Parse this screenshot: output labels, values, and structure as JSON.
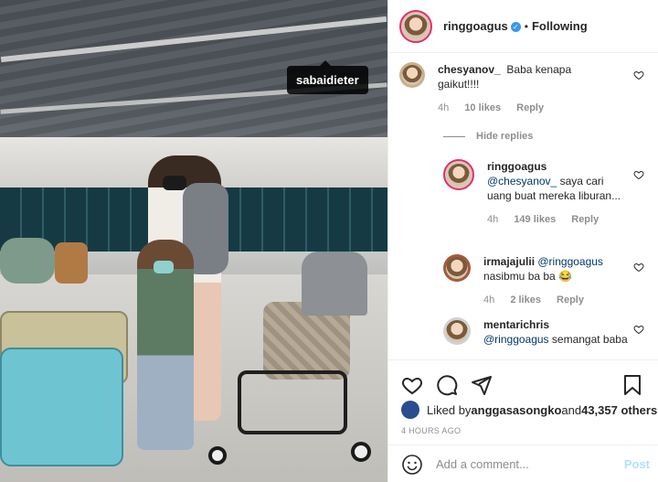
{
  "photo": {
    "tag_label": "sabaidieter"
  },
  "header": {
    "username": "ringgoagus",
    "separator": "•",
    "follow_status": "Following"
  },
  "comments": [
    {
      "username": "chesyanov_",
      "text": "Baba kenapa gaikut!!!!",
      "time": "4h",
      "likes": "10 likes",
      "reply": "Reply"
    }
  ],
  "hide_replies": "Hide replies",
  "replies": [
    {
      "username": "ringgoagus",
      "mention": "@chesyanov_",
      "text": " saya cari uang buat mereka liburan...",
      "time": "4h",
      "likes": "149 likes",
      "reply": "Reply"
    },
    {
      "username": "irmajajulii",
      "mention": "@ringgoagus",
      "text": "nasibmu ba ba 😂",
      "time": "4h",
      "likes": "2 likes",
      "reply": "Reply"
    },
    {
      "username": "mentarichris",
      "mention": "@ringgoagus",
      "text": " semangat baba"
    }
  ],
  "likes": {
    "prefix": "Liked by ",
    "user": "anggasasongko",
    "middle": " and ",
    "count": "43,357 others"
  },
  "timestamp": "4 HOURS AGO",
  "add_comment": {
    "placeholder": "Add a comment...",
    "post_label": "Post"
  },
  "colors": {
    "link": "#00376b",
    "muted": "#8e8e8e",
    "verified": "#3897f0",
    "post_disabled": "#b2dffc"
  },
  "icons": [
    "heart-icon",
    "comment-icon",
    "share-icon",
    "bookmark-icon",
    "emoji-icon",
    "verified-icon"
  ]
}
